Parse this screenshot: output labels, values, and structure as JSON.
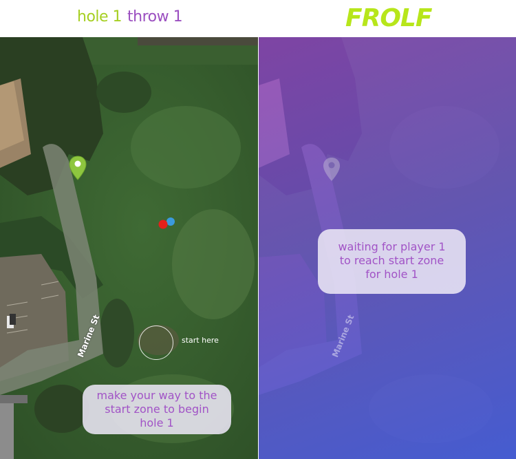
{
  "header": {
    "hole_text": "hole 1",
    "throw_text": "throw 1",
    "brand": "FROLF"
  },
  "colors": {
    "hole_green": "#a6cf22",
    "throw_purple": "#9b4fc0",
    "brand_green": "#b7e61b",
    "bubble_text": "#a153c6"
  },
  "map": {
    "street_name": "Marine St",
    "start_label": "start here"
  },
  "left_message": {
    "line1": "make your way to the",
    "line2": "start zone to begin",
    "line3": "hole 1"
  },
  "right_message": {
    "line1": "waiting for player 1",
    "line2": "to reach start zone",
    "line3": "for hole 1"
  },
  "icons": {
    "target_pin": "map-pin-icon",
    "player_dot": "player-location-icon",
    "gps_dot": "gps-location-icon"
  }
}
